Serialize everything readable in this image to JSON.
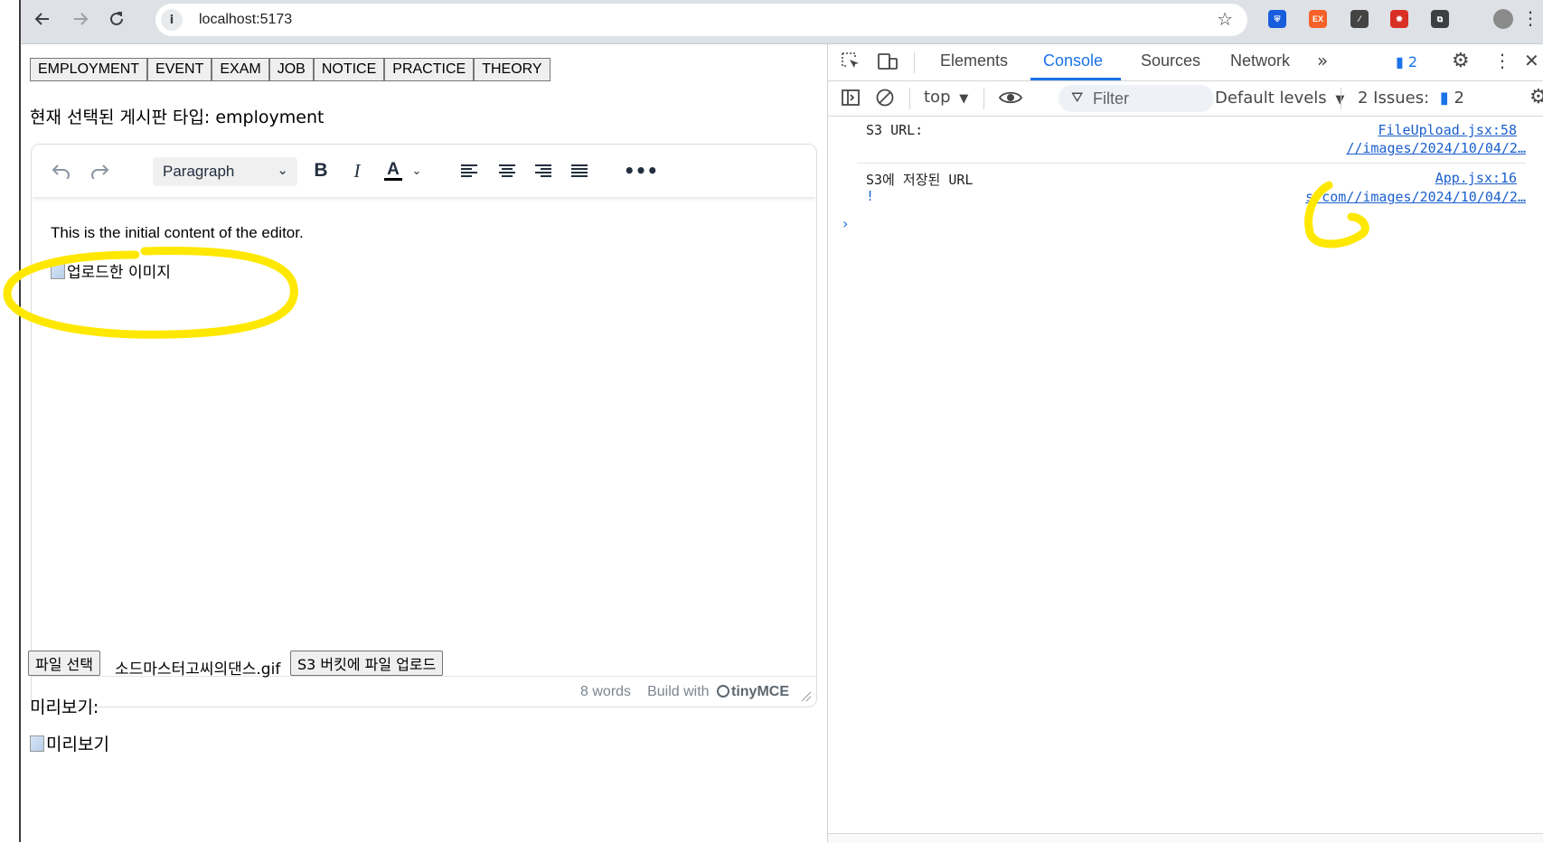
{
  "browser": {
    "url": "localhost:5173",
    "back_icon": "arrow-left-icon",
    "forward_icon": "arrow-right-icon",
    "reload_icon": "reload-icon",
    "extensions": [
      {
        "name": "bitwarden-extension",
        "color": "#175ddc",
        "glyph": "⛨"
      },
      {
        "name": "ex-extension",
        "color": "#f4622a",
        "glyph": "EX"
      },
      {
        "name": "slash-extension",
        "color": "#444444",
        "glyph": "⁄"
      },
      {
        "name": "bug-extension",
        "color": "#d93025",
        "glyph": "✹"
      },
      {
        "name": "puzzle-extension",
        "color": "#3c4043",
        "glyph": "⧉"
      }
    ]
  },
  "page": {
    "tabs": [
      "EMPLOYMENT",
      "EVENT",
      "EXAM",
      "JOB",
      "NOTICE",
      "PRACTICE",
      "THEORY"
    ],
    "board_type_label": "현재 선택된 게시판 타입: employment",
    "editor": {
      "format_value": "Paragraph",
      "content_text": "This is the initial content of the editor.",
      "image_alt": "업로드한 이미지",
      "word_count": "8 words",
      "build_with": "Build with",
      "brand": "tinyMCE"
    },
    "file_button": "파일 선택",
    "file_name": "소드마스터고씨의댄스.gif",
    "upload_button": "S3 버킷에 파일 업로드",
    "preview_label": "미리보기:",
    "preview_alt": "미리보기"
  },
  "devtools": {
    "tabs": [
      "Elements",
      "Console",
      "Sources",
      "Network"
    ],
    "active_tab": "Console",
    "message_badge": "2",
    "context": "top",
    "filter_placeholder": "Filter",
    "levels": "Default levels",
    "issues_label": "2 Issues:",
    "issues_count": "2",
    "console": [
      {
        "text": "S3 URL:",
        "source": "FileUpload.jsx:58",
        "value": "//images/2024/10/04/2…"
      },
      {
        "text": "S3에 저장된 URL",
        "source": "App.jsx:16",
        "value": "s.com//images/2024/10/04/2…"
      }
    ]
  },
  "colors": {
    "accent": "#1a73e8",
    "highlight": "#ffe800"
  }
}
